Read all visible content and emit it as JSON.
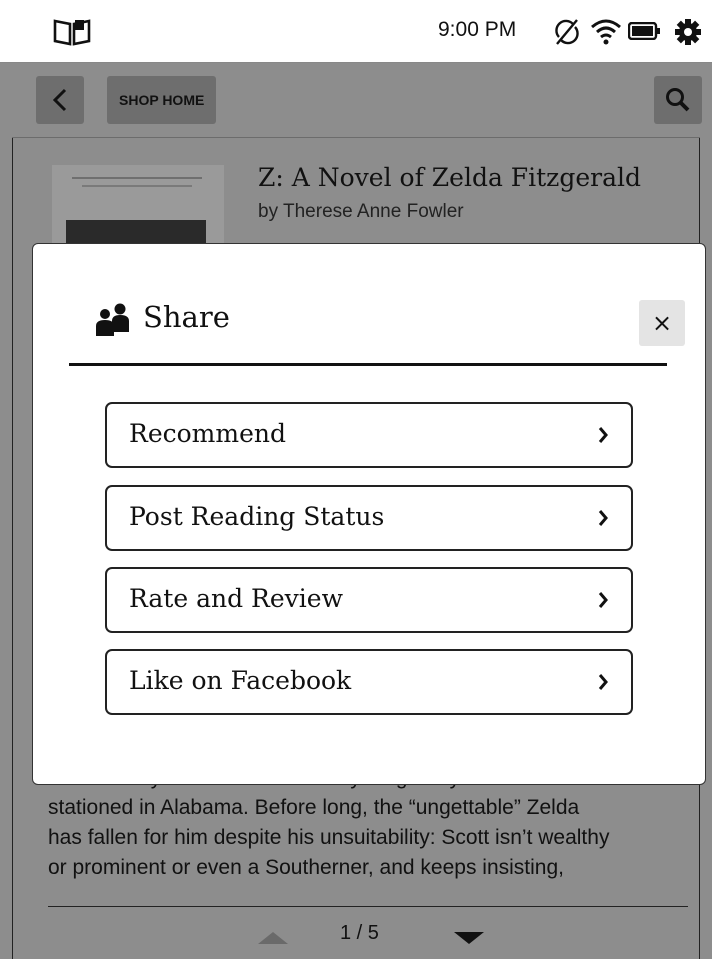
{
  "status_bar": {
    "time": "9:00 PM",
    "icons": [
      "book-icon",
      "sync-off-icon",
      "wifi-icon",
      "battery-icon",
      "gear-icon"
    ]
  },
  "nav": {
    "back_icon": "chevron-left-icon",
    "shop_home_label": "SHOP HOME",
    "search_icon": "search-icon"
  },
  "book": {
    "title": "Z: A Novel of Zelda Fitzgerald",
    "author": "by Therese Anne Fowler",
    "description_lines": [
      "seventeen years old and he is a young army lieutenant",
      "stationed in Alabama. Before long, the “ungettable” Zelda",
      "has fallen for him despite his unsuitability: Scott isn’t wealthy",
      "or prominent or even a Southerner, and keeps insisting,"
    ]
  },
  "pager": {
    "page_label": "1 / 5",
    "prev_icon": "triangle-up-icon",
    "next_icon": "triangle-down-icon"
  },
  "dialog": {
    "title": "Share",
    "title_icon": "people-icon",
    "close_label": "×",
    "options": [
      {
        "label": "Recommend"
      },
      {
        "label": "Post Reading Status"
      },
      {
        "label": "Rate and Review"
      },
      {
        "label": "Like on Facebook"
      }
    ]
  },
  "colors": {
    "overlay_gray": "#8d8d8d",
    "button_gray": "#6e6e6e",
    "close_bg": "#e4e4e4"
  }
}
